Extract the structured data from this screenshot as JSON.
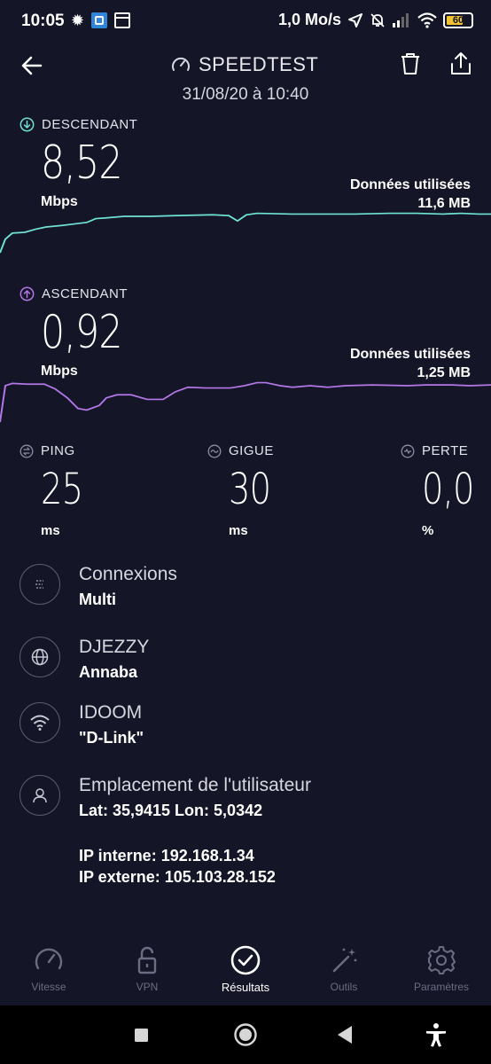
{
  "status_bar": {
    "time": "10:05",
    "net_speed": "1,0 Mo/s",
    "battery": "60",
    "battery_color": "#f1c232"
  },
  "header": {
    "title": "SPEEDTEST",
    "date": "31/08/20 à 10:40"
  },
  "download": {
    "label": "DESCENDANT",
    "value": "8,52",
    "unit": "Mbps",
    "data_used_label": "Données utilisées",
    "data_used_value": "11,6 MB",
    "color": "#6fe3d3"
  },
  "upload": {
    "label": "ASCENDANT",
    "value": "0,92",
    "unit": "Mbps",
    "data_used_label": "Données utilisées",
    "data_used_value": "1,25 MB",
    "color": "#b377e8"
  },
  "stats": {
    "ping": {
      "label": "PING",
      "value": "25",
      "unit": "ms"
    },
    "jitter": {
      "label": "GIGUE",
      "value": "30",
      "unit": "ms"
    },
    "loss": {
      "label": "PERTE",
      "value": "0,0",
      "unit": "%"
    }
  },
  "info": {
    "connections": {
      "title": "Connexions",
      "value": "Multi"
    },
    "provider": {
      "title": "DJEZZY",
      "value": "Annaba"
    },
    "server": {
      "title": "IDOOM",
      "value": "\"D-Link\""
    },
    "location": {
      "title": "Emplacement de l'utilisateur",
      "value": "Lat: 35,9415 Lon: 5,0342"
    },
    "ip_internal": "IP interne: 192.168.1.34",
    "ip_external": "IP externe: 105.103.28.152"
  },
  "bottom_nav": {
    "items": [
      {
        "label": "Vitesse",
        "icon": "speedometer-icon",
        "active": false
      },
      {
        "label": "VPN",
        "icon": "unlock-icon",
        "active": false
      },
      {
        "label": "Résultats",
        "icon": "check-circle-icon",
        "active": true
      },
      {
        "label": "Outils",
        "icon": "magic-wand-icon",
        "active": false
      },
      {
        "label": "Paramètres",
        "icon": "gear-icon",
        "active": false
      }
    ]
  }
}
